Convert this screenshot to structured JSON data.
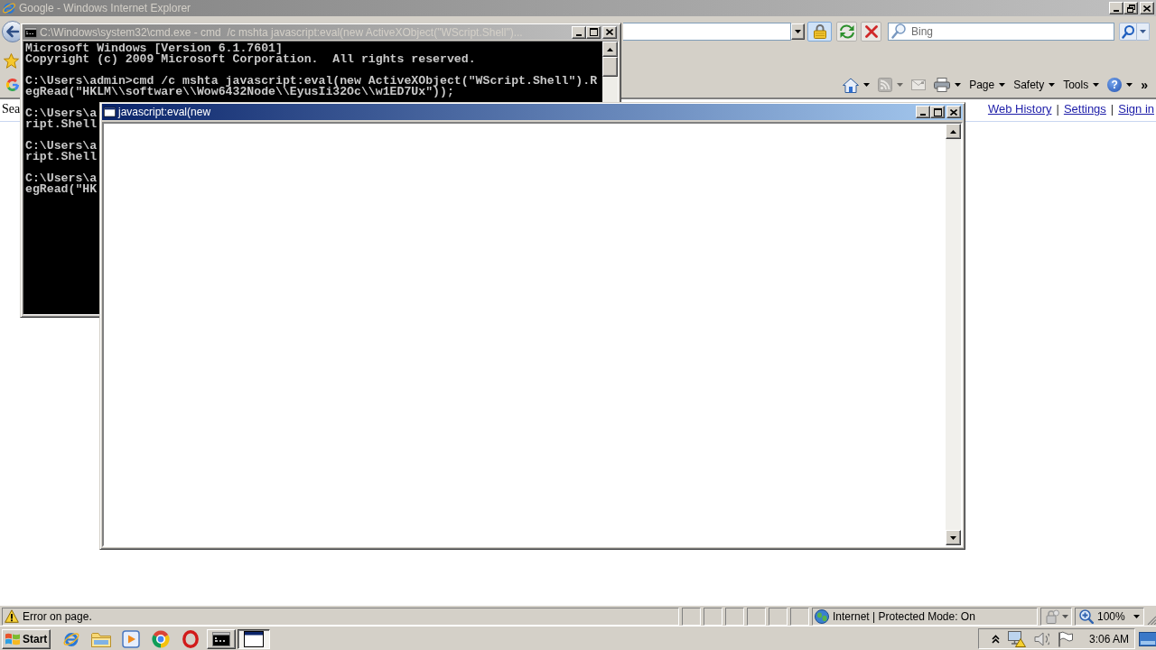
{
  "ie_window": {
    "title": "Google - Windows Internet Explorer",
    "active": false,
    "maximized": true,
    "toolbar": {
      "search_placeholder": "Bing",
      "command_buttons": [
        {
          "kind": "home",
          "disabled": false,
          "dropdown": true
        },
        {
          "kind": "feeds",
          "disabled": true,
          "dropdown": true
        },
        {
          "kind": "mail",
          "disabled": true,
          "dropdown": false
        },
        {
          "kind": "print",
          "disabled": false,
          "dropdown": true
        }
      ],
      "menus": [
        {
          "label": "Page"
        },
        {
          "label": "Safety"
        },
        {
          "label": "Tools"
        }
      ],
      "help_glyph": "?",
      "overflow": "»"
    },
    "page": {
      "partial_text": "Sea",
      "header_items": [
        {
          "kind": "link",
          "text": "Web History"
        },
        {
          "kind": "separator",
          "text": "|"
        },
        {
          "kind": "link",
          "text": "Settings"
        },
        {
          "kind": "separator",
          "text": "|"
        },
        {
          "kind": "link",
          "text": "Sign in"
        }
      ]
    },
    "status_bar": {
      "message": "Error on page.",
      "zone": "Internet | Protected Mode: On",
      "zoom": "100%"
    }
  },
  "cmd_window": {
    "title": "C:\\Windows\\system32\\cmd.exe - cmd  /c mshta javascript:eval(new ActiveXObject(\"WScript.Shell\")...",
    "active": false,
    "maximized": false,
    "blocks": [
      [
        "Microsoft Windows [Version 6.1.7601]",
        "Copyright (c) 2009 Microsoft Corporation.  All rights reserved."
      ],
      [
        "C:\\Users\\admin>cmd /c mshta javascript:eval(new ActiveXObject(\"WScript.Shell\").R",
        "egRead(\"HKLM\\\\software\\\\Wow6432Node\\\\EyusIi32Oc\\\\w1ED7Ux\"));"
      ],
      [
        "C:\\Users\\a",
        "ript.Shell"
      ],
      [
        "C:\\Users\\a",
        "ript.Shell"
      ],
      [
        "C:\\Users\\a",
        "egRead(\"HK"
      ]
    ]
  },
  "popup_window": {
    "title": "javascript:eval(new",
    "active": true,
    "maximized": false
  },
  "taskbar": {
    "start": "Start",
    "quick_launch": [
      {
        "kind": "e-logo"
      },
      {
        "kind": "folder"
      },
      {
        "kind": "play"
      },
      {
        "kind": "segmented-circle"
      },
      {
        "kind": "ring"
      }
    ],
    "tasks": [
      {
        "kind": "console",
        "selected": false
      },
      {
        "kind": "window",
        "selected": true
      }
    ],
    "clock": "3:06 AM"
  }
}
